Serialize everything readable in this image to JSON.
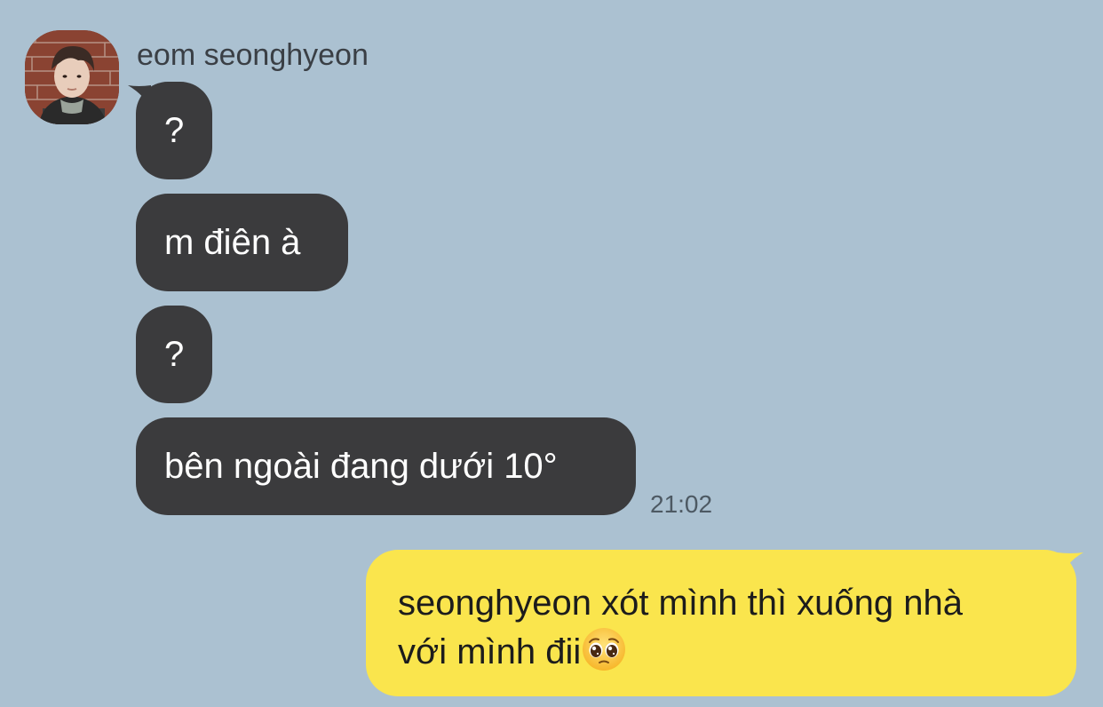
{
  "chat": {
    "sender_name": "eom seonghyeon",
    "incoming": [
      {
        "text": "?"
      },
      {
        "text": "m điên à"
      },
      {
        "text": "?"
      },
      {
        "text": "bên ngoài đang dưới 10°"
      }
    ],
    "incoming_time": "21:02",
    "outgoing": {
      "line1": "seonghyeon xót mình thì xuống nhà",
      "line2": "với mình đii",
      "emoji": "pleading-face-emoji"
    },
    "colors": {
      "background": "#abc1d1",
      "incoming_bubble": "#3b3b3d",
      "outgoing_bubble": "#fae54d"
    }
  }
}
